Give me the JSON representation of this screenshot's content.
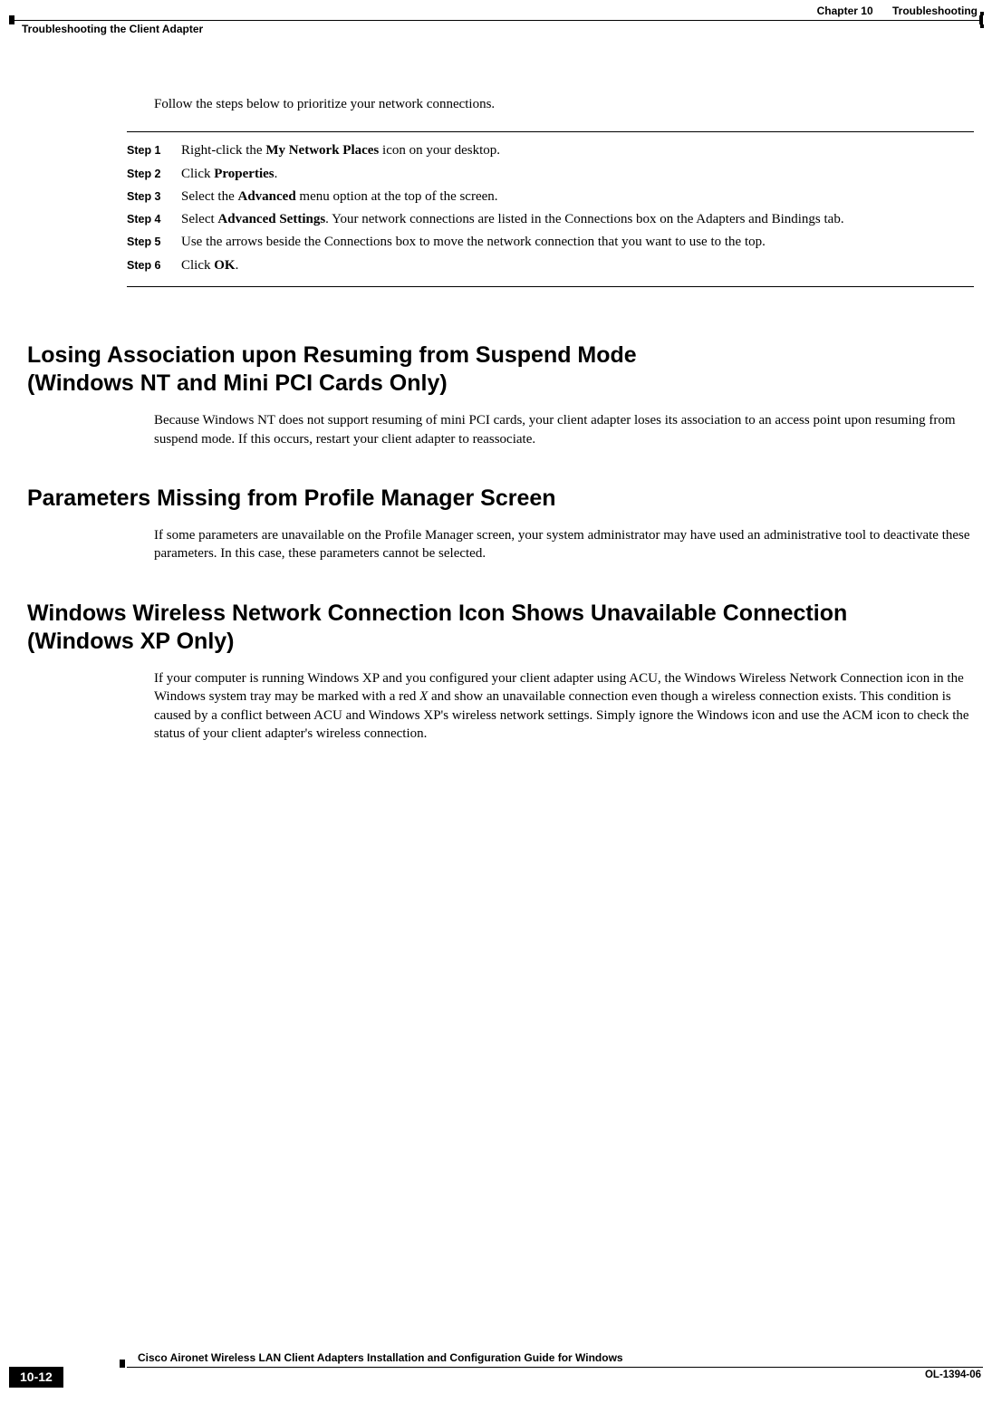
{
  "header": {
    "chapter_label": "Chapter 10",
    "chapter_title": "Troubleshooting",
    "section_title": "Troubleshooting the Client Adapter"
  },
  "intro": "Follow the steps below to prioritize your network connections.",
  "steps": [
    {
      "label": "Step 1",
      "prefix": "Right-click the ",
      "bold": "My Network Places",
      "suffix": " icon on your desktop."
    },
    {
      "label": "Step 2",
      "prefix": "Click ",
      "bold": "Properties",
      "suffix": "."
    },
    {
      "label": "Step 3",
      "prefix": "Select the ",
      "bold": "Advanced",
      "suffix": " menu option at the top of the screen."
    },
    {
      "label": "Step 4",
      "prefix": "Select ",
      "bold": "Advanced Settings",
      "suffix": ". Your network connections are listed in the Connections box on the Adapters and Bindings tab."
    },
    {
      "label": "Step 5",
      "prefix": "",
      "bold": "",
      "suffix": "Use the arrows beside the Connections box to move the network connection that you want to use to the top."
    },
    {
      "label": "Step 6",
      "prefix": "Click ",
      "bold": "OK",
      "suffix": "."
    }
  ],
  "sections": [
    {
      "heading_line1": "Losing Association upon Resuming from Suspend Mode",
      "heading_line2": "(Windows NT and Mini PCI Cards Only)",
      "body": "Because Windows NT does not support resuming of mini PCI cards, your client adapter loses its association to an access point upon resuming from suspend mode. If this occurs, restart your client adapter to reassociate."
    },
    {
      "heading_line1": "Parameters Missing from Profile Manager Screen",
      "heading_line2": "",
      "body": "If some parameters are unavailable on the Profile Manager screen, your system administrator may have used an administrative tool to deactivate these parameters. In this case, these parameters cannot be selected."
    },
    {
      "heading_line1": "Windows Wireless Network Connection Icon Shows Unavailable Connection",
      "heading_line2": "(Windows XP Only)",
      "body_before_italic": "If your computer is running Windows XP and you configured your client adapter using ACU, the Windows Wireless Network Connection icon in the Windows system tray may be marked with a red ",
      "italic": "X",
      "body_after_italic": " and show an unavailable connection even though a wireless connection exists. This condition is caused by a conflict between ACU and Windows XP's wireless network settings. Simply ignore the Windows icon and use the ACM icon to check the status of your client adapter's wireless connection."
    }
  ],
  "footer": {
    "doc_title": "Cisco Aironet Wireless LAN Client Adapters Installation and Configuration Guide for Windows",
    "page_number": "10-12",
    "doc_id": "OL-1394-06"
  }
}
